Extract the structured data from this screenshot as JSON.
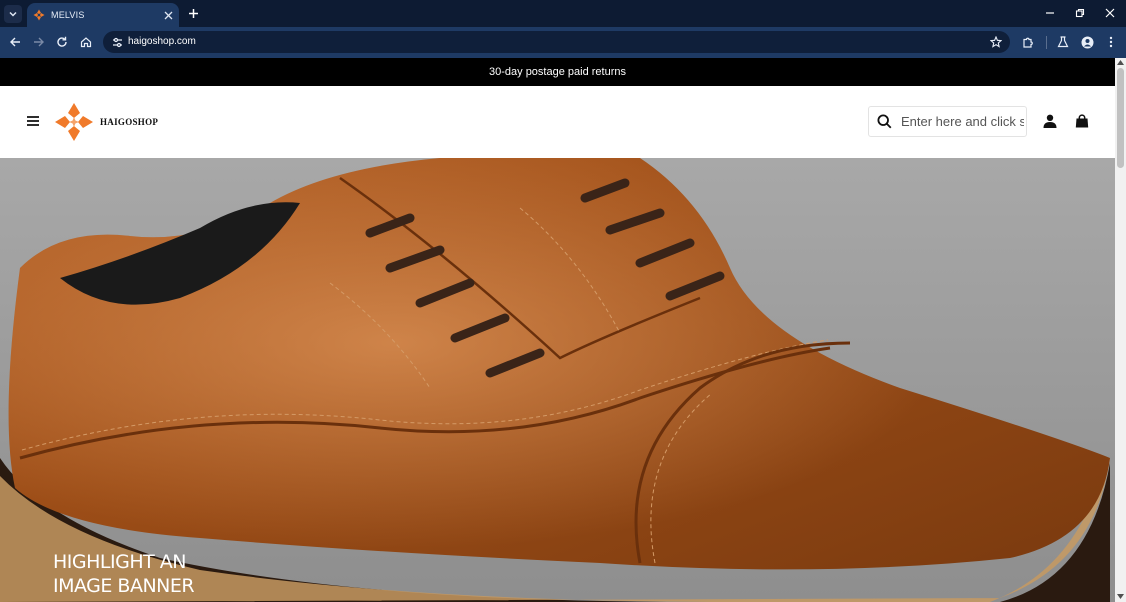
{
  "browser": {
    "tab": {
      "title": "MELVIS",
      "favicon": "logo-icon"
    },
    "omnibox": {
      "url": "haigoshop.com"
    },
    "icons": {
      "tab_list": "chevron-down-icon",
      "tab_close": "close-icon",
      "new_tab": "plus-icon",
      "minimize": "minimize-icon",
      "restore": "restore-icon",
      "close_window": "close-icon",
      "back": "back-arrow-icon",
      "forward": "forward-arrow-icon",
      "reload": "reload-icon",
      "home": "home-icon",
      "site_info": "tune-icon",
      "bookmark": "star-icon",
      "extensions": "puzzle-icon",
      "labs": "flask-icon",
      "profile": "profile-icon",
      "menu": "kebab-icon"
    }
  },
  "announcement": {
    "text": "30-day postage paid returns"
  },
  "header": {
    "logo_text": "HAIGOSHOP",
    "search": {
      "placeholder": "Enter here and click search"
    }
  },
  "banner": {
    "headline_line1": "HIGHLIGHT AN",
    "headline_line2": "IMAGE BANNER",
    "image": "brown leather oxford shoe"
  },
  "colors": {
    "chrome_dark": "#0d1b33",
    "chrome_toolbar": "#1e3a64",
    "logo_orange": "#f07a2a",
    "announcement_bg": "#000000",
    "leather": "#a9541c"
  }
}
